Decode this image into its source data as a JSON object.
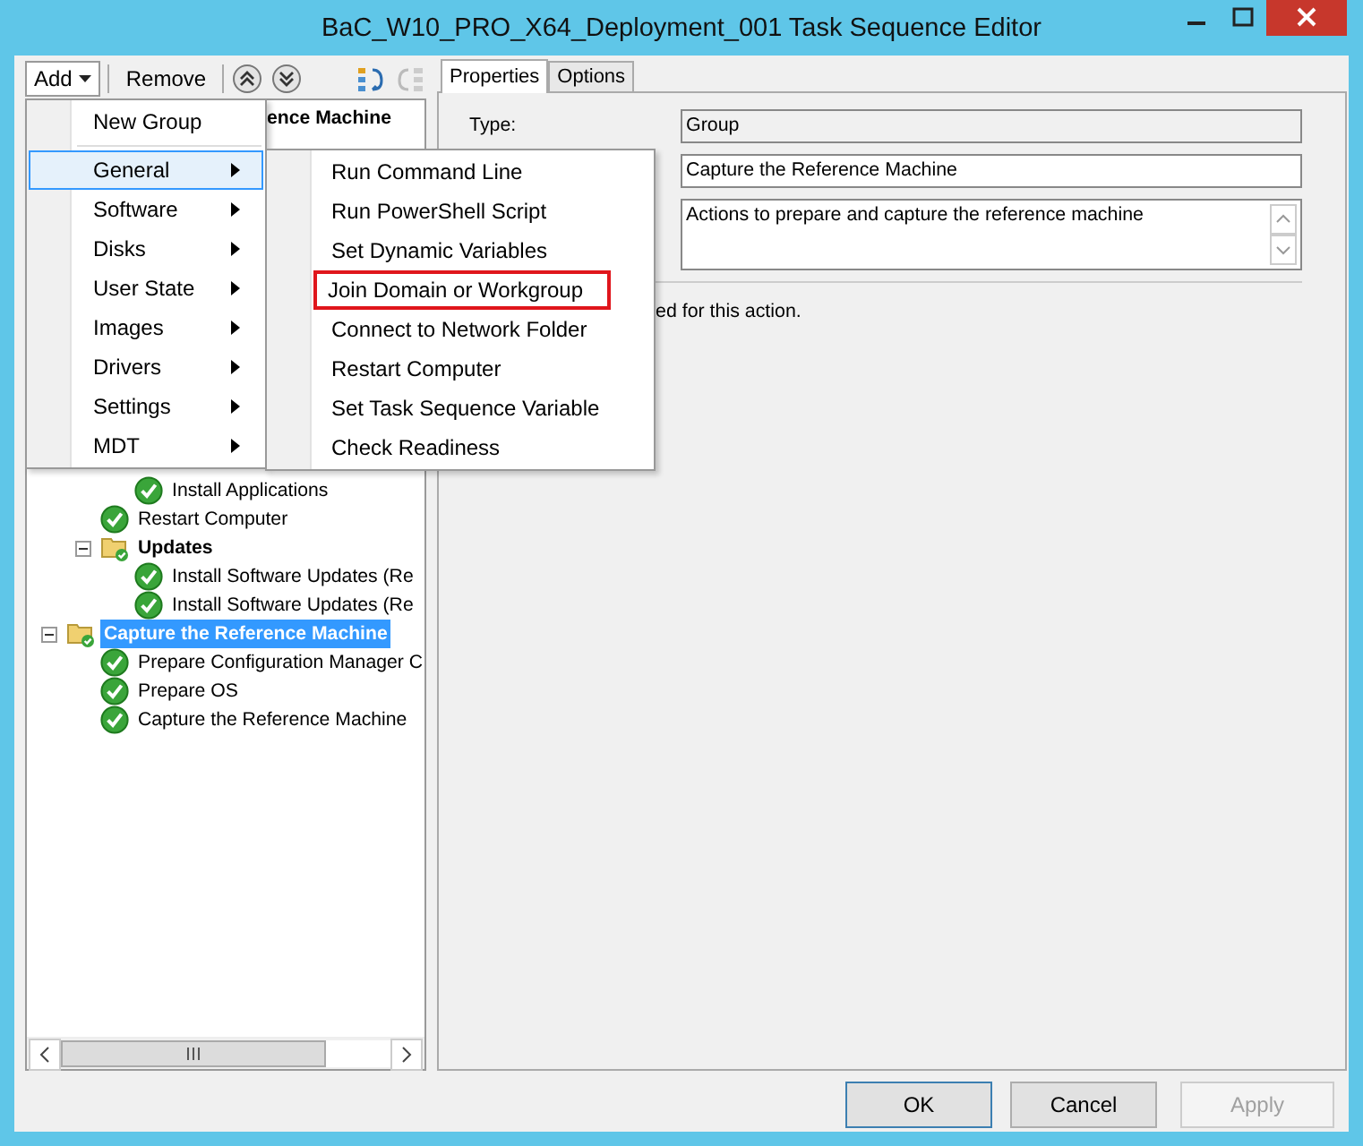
{
  "window": {
    "title": "BaC_W10_PRO_X64_Deployment_001 Task Sequence Editor"
  },
  "toolbar": {
    "add": "Add",
    "remove": "Remove"
  },
  "tree": [
    {
      "label": "ence Machine",
      "kind": "partial",
      "selected": false,
      "children": [
        {
          "kind": "covered",
          "children": [
            {
              "label": "Install Applications",
              "kind": "step",
              "selected": false
            }
          ]
        },
        {
          "label": "Restart Computer",
          "kind": "step",
          "selected": false
        },
        {
          "label": "Updates",
          "kind": "group",
          "expanded": true,
          "selected": false,
          "children": [
            {
              "label": "Install Software Updates (Re",
              "kind": "step",
              "selected": false
            },
            {
              "label": "Install Software Updates (Re",
              "kind": "step",
              "selected": false
            }
          ]
        }
      ]
    },
    {
      "label": "Capture the Reference Machine",
      "kind": "group",
      "expanded": true,
      "selected": true,
      "children": [
        {
          "label": "Prepare Configuration Manager C",
          "kind": "step",
          "selected": false
        },
        {
          "label": "Prepare OS",
          "kind": "step",
          "selected": false
        },
        {
          "label": "Capture the Reference Machine",
          "kind": "step",
          "selected": false
        }
      ]
    }
  ],
  "add_menu": [
    {
      "label": "New Group",
      "selected": false,
      "separator_after": true
    },
    {
      "label": "General",
      "submenu": true,
      "selected": true
    },
    {
      "label": "Software",
      "submenu": true,
      "selected": false
    },
    {
      "label": "Disks",
      "submenu": true,
      "selected": false
    },
    {
      "label": "User State",
      "submenu": true,
      "selected": false
    },
    {
      "label": "Images",
      "submenu": true,
      "selected": false
    },
    {
      "label": "Drivers",
      "submenu": true,
      "selected": false
    },
    {
      "label": "Settings",
      "submenu": true,
      "selected": false
    },
    {
      "label": "MDT",
      "submenu": true,
      "selected": false
    }
  ],
  "general_menu": [
    {
      "label": "Run Command Line",
      "outlined": false
    },
    {
      "label": "Run PowerShell Script",
      "outlined": false
    },
    {
      "label": "Set Dynamic Variables",
      "outlined": false
    },
    {
      "label": "Join Domain or Workgroup",
      "outlined": true
    },
    {
      "label": "Connect to Network Folder",
      "outlined": false
    },
    {
      "label": "Restart Computer",
      "outlined": false
    },
    {
      "label": "Set Task Sequence Variable",
      "outlined": false
    },
    {
      "label": "Check Readiness",
      "outlined": false
    }
  ],
  "tabs": [
    {
      "label": "Properties",
      "selected": true
    },
    {
      "label": "Options",
      "selected": false
    }
  ],
  "properties": {
    "type_label": "Type:",
    "type_value": "Group",
    "name_value": "Capture the Reference Machine",
    "description_value": "Actions to prepare and capture the reference machine",
    "note": "ed  for this action."
  },
  "buttons": [
    {
      "label": "OK",
      "default": true,
      "disabled": false
    },
    {
      "label": "Cancel",
      "default": false,
      "disabled": false
    },
    {
      "label": "Apply",
      "default": false,
      "disabled": true
    }
  ]
}
